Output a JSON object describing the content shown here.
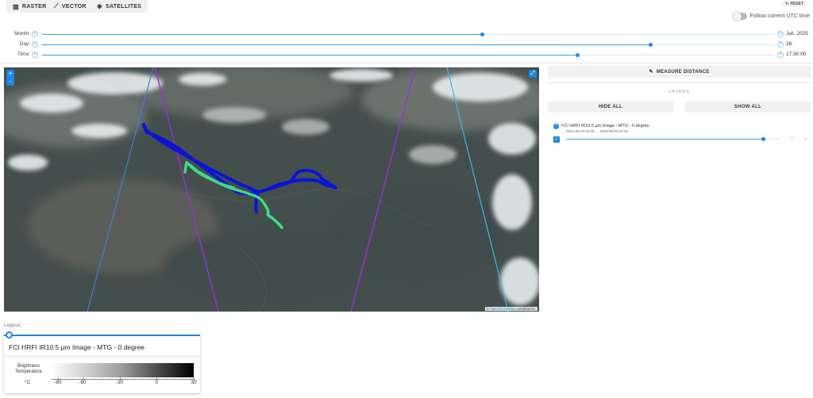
{
  "toolbar": {
    "raster": "RASTER",
    "vector": "VECTOR",
    "satellites": "SATELLITES",
    "reset": "RESET",
    "follow_utc": "Follow current UTC time"
  },
  "time": {
    "month": {
      "label": "Month:",
      "value": "Juli. 2025",
      "prev": "<",
      "next": ">",
      "position": 0.6
    },
    "day": {
      "label": "Day:",
      "value": "26.",
      "prev": "<",
      "next": ">",
      "position": 0.83
    },
    "time": {
      "label": "Time:",
      "value": "17:30:00",
      "prev": "<",
      "next": ">",
      "position": 0.73
    }
  },
  "map": {
    "zoom_in": "+",
    "zoom_out": "-",
    "attribution_prefix": "©",
    "attribution_link": "OpenStreetMap",
    "attribution_suffix": "contributors.",
    "colors": {
      "track_blue": "#0a14d8",
      "track_green": "#3ddc84",
      "orbit_blue": "#4a7bd8",
      "orbit_purple": "#9b30d9",
      "orbit_cyan": "#3ab8e8"
    }
  },
  "panel": {
    "measure": "MEASURE DISTANCE",
    "layers_title": "LAYERS",
    "hide_all": "HIDE ALL",
    "show_all": "SHOW ALL",
    "layer": {
      "name": "FCI HRFI IR10.5 µm Image - MTG - 0 degree",
      "dates": "2024-09-23 00:00 → 2025-09-04 07:10",
      "checked": true,
      "opacity": 0.92,
      "mark1": "–",
      "mark2": "⌄"
    }
  },
  "legend": {
    "label": "Legend:",
    "title": "FCI HRFI IR10.5 µm Image - MTG - 0 degree",
    "quantity": "Brightness Temperature",
    "unit": "°C",
    "ticks": [
      "-80",
      "-60",
      "-30",
      "0",
      "30"
    ],
    "tick_values": [
      -80,
      -60,
      -30,
      0,
      30
    ],
    "range": [
      -85,
      30
    ]
  }
}
